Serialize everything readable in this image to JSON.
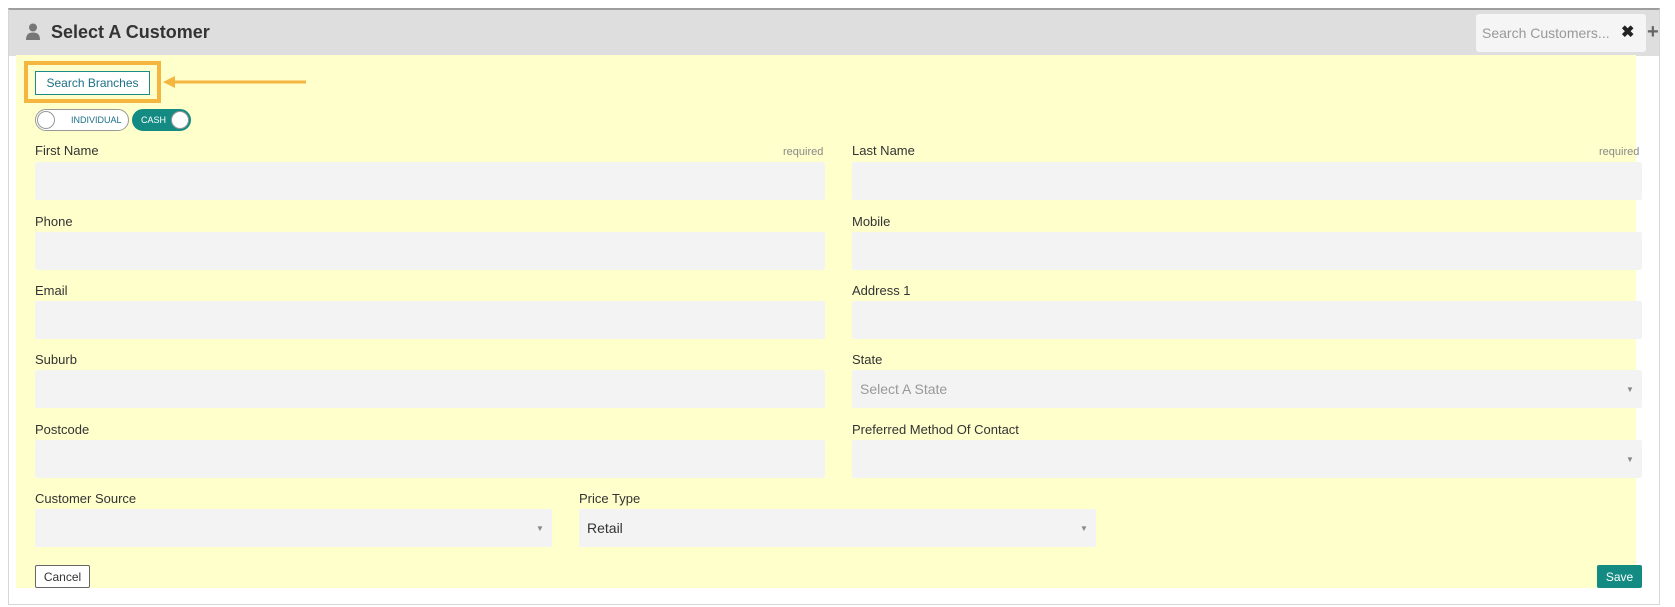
{
  "header": {
    "title": "Select A Customer",
    "search_placeholder": "Search Customers...",
    "clear_glyph": "✖",
    "add_glyph": "+"
  },
  "toolbar": {
    "search_branches_label": "Search Branches",
    "individual_toggle_label": "INDIVIDUAL",
    "cash_toggle_label": "CASH"
  },
  "form": {
    "first_name": {
      "label": "First Name",
      "required": "required",
      "value": ""
    },
    "last_name": {
      "label": "Last Name",
      "required": "required",
      "value": ""
    },
    "phone": {
      "label": "Phone",
      "value": ""
    },
    "mobile": {
      "label": "Mobile",
      "value": ""
    },
    "email": {
      "label": "Email",
      "value": ""
    },
    "address1": {
      "label": "Address 1",
      "value": ""
    },
    "suburb": {
      "label": "Suburb",
      "value": ""
    },
    "state": {
      "label": "State",
      "placeholder": "Select A State"
    },
    "postcode": {
      "label": "Postcode",
      "value": ""
    },
    "preferred_contact": {
      "label": "Preferred Method Of Contact",
      "value": ""
    },
    "customer_source": {
      "label": "Customer Source",
      "value": ""
    },
    "price_type": {
      "label": "Price Type",
      "value": "Retail"
    }
  },
  "actions": {
    "cancel_label": "Cancel",
    "save_label": "Save"
  },
  "colors": {
    "accent": "#138b83",
    "form_background": "#ffffcc",
    "highlight": "#f4b63f"
  },
  "icons": {
    "header": "user-icon",
    "clear": "close-icon",
    "add": "plus-icon",
    "annotation": "arrow-left-icon"
  }
}
